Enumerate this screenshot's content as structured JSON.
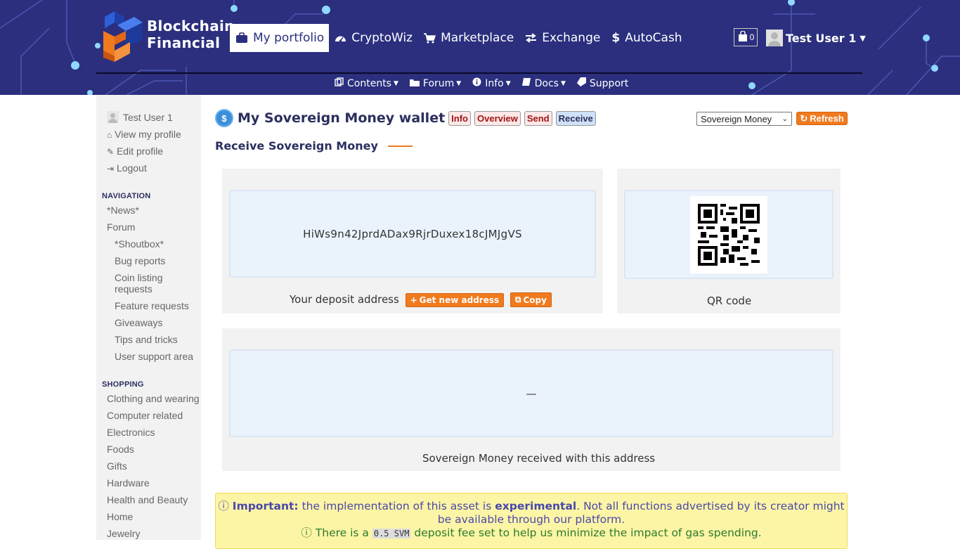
{
  "brand": {
    "line1": "Blockchain",
    "line2": "Financial"
  },
  "topnav": [
    {
      "label": "My portfolio",
      "icon": "briefcase-icon",
      "active": true
    },
    {
      "label": "CryptoWiz",
      "icon": "dashboard-icon"
    },
    {
      "label": "Marketplace",
      "icon": "cart-icon"
    },
    {
      "label": "Exchange",
      "icon": "exchange-icon"
    },
    {
      "label": "AutoCash",
      "icon": "dollar-icon"
    }
  ],
  "cart": {
    "count": "0"
  },
  "user": {
    "name": "Test User 1"
  },
  "subnav": [
    {
      "label": "Contents",
      "icon": "copy-icon"
    },
    {
      "label": "Forum",
      "icon": "folder-icon"
    },
    {
      "label": "Info",
      "icon": "info-icon"
    },
    {
      "label": "Docs",
      "icon": "book-icon"
    },
    {
      "label": "Support",
      "icon": "ticket-icon"
    }
  ],
  "sidebar": {
    "user_name": "Test User 1",
    "view_profile": "View my profile",
    "edit_profile": "Edit profile",
    "logout": "Logout",
    "navigation_heading": "NAVIGATION",
    "nav_items": [
      "*News*",
      "Forum",
      "*Shoutbox*",
      "Bug reports",
      "Coin listing",
      "requests",
      "Feature requests",
      "Giveaways",
      "Tips and tricks",
      "User support area"
    ],
    "shopping_heading": "SHOPPING",
    "shop_items": [
      "Clothing and wearing",
      "Computer related",
      "Electronics",
      "Foods",
      "Gifts",
      "Hardware",
      "Health and Beauty",
      "Home",
      "Jewelry"
    ]
  },
  "wallet": {
    "title": "My Sovereign Money wallet",
    "tabs": [
      "Info",
      "Overview",
      "Send",
      "Receive"
    ],
    "selected_asset": "Sovereign Money",
    "refresh_label": "Refresh",
    "subtitle": "Receive Sovereign Money",
    "address": "HiWs9n42JprdADax9RjrDuxex18cJMJgVS",
    "deposit_caption": "Your deposit address",
    "new_address_label": "Get new address",
    "copy_label": "Copy",
    "qr_caption": "QR code",
    "received_value": "—",
    "received_caption": "Sovereign Money received with this address"
  },
  "notice": {
    "important_label": "Important:",
    "line1_a": "the implementation of this asset is",
    "experimental": "experimental",
    "line1_b": ". Not all functions advertised by its creator might be available through our platform.",
    "line2_a": "There is a",
    "fee": "0.5 SVM",
    "line2_b": "deposit fee set to help us minimize the impact of gas spending."
  },
  "colors": {
    "header_bg": "#2b2f7e",
    "accent": "#f07a1e",
    "title": "#2b2f5e",
    "notice_bg": "#fdf5a6"
  }
}
